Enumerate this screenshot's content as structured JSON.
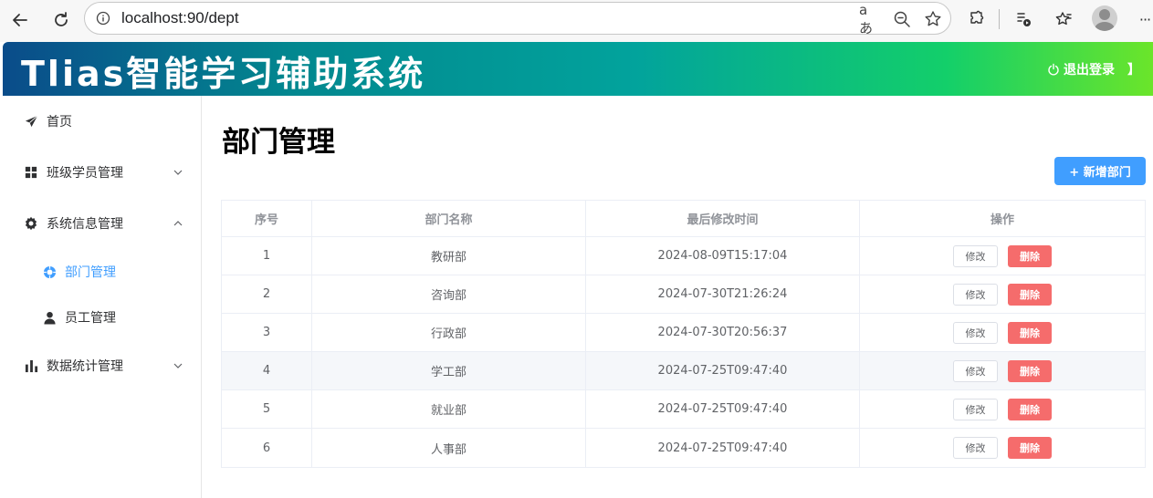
{
  "browser": {
    "url": "localhost:90/dept",
    "translate_glyph": "aあ",
    "more_glyph": "···"
  },
  "header": {
    "title": "Tlias智能学习辅助系统",
    "logout_label": "退出登录",
    "logout_bracket": "】",
    "gradient_colors": [
      "#0a4c8a",
      "#02878f",
      "#02a39c",
      "#13cf6a",
      "#6be52a"
    ]
  },
  "sidebar": {
    "items": [
      {
        "label": "首页",
        "icon": "paper-plane-icon"
      },
      {
        "label": "班级学员管理",
        "icon": "grid-icon",
        "expanded": false
      },
      {
        "label": "系统信息管理",
        "icon": "gear-icon",
        "expanded": true
      },
      {
        "label": "部门管理",
        "icon": "target-icon",
        "active": true
      },
      {
        "label": "员工管理",
        "icon": "user-icon"
      },
      {
        "label": "数据统计管理",
        "icon": "bar-chart-icon",
        "expanded": false
      }
    ],
    "active_color": "#409eff"
  },
  "main": {
    "title": "部门管理",
    "add_button": "+ 新增部门",
    "table": {
      "headers": [
        "序号",
        "部门名称",
        "最后修改时间",
        "操作"
      ],
      "rows": [
        {
          "index": "1",
          "name": "教研部",
          "updated": "2024-08-09T15:17:04"
        },
        {
          "index": "2",
          "name": "咨询部",
          "updated": "2024-07-30T21:26:24"
        },
        {
          "index": "3",
          "name": "行政部",
          "updated": "2024-07-30T20:56:37"
        },
        {
          "index": "4",
          "name": "学工部",
          "updated": "2024-07-25T09:47:40"
        },
        {
          "index": "5",
          "name": "就业部",
          "updated": "2024-07-25T09:47:40"
        },
        {
          "index": "6",
          "name": "人事部",
          "updated": "2024-07-25T09:47:40"
        }
      ],
      "edit_label": "修改",
      "delete_label": "删除"
    }
  }
}
